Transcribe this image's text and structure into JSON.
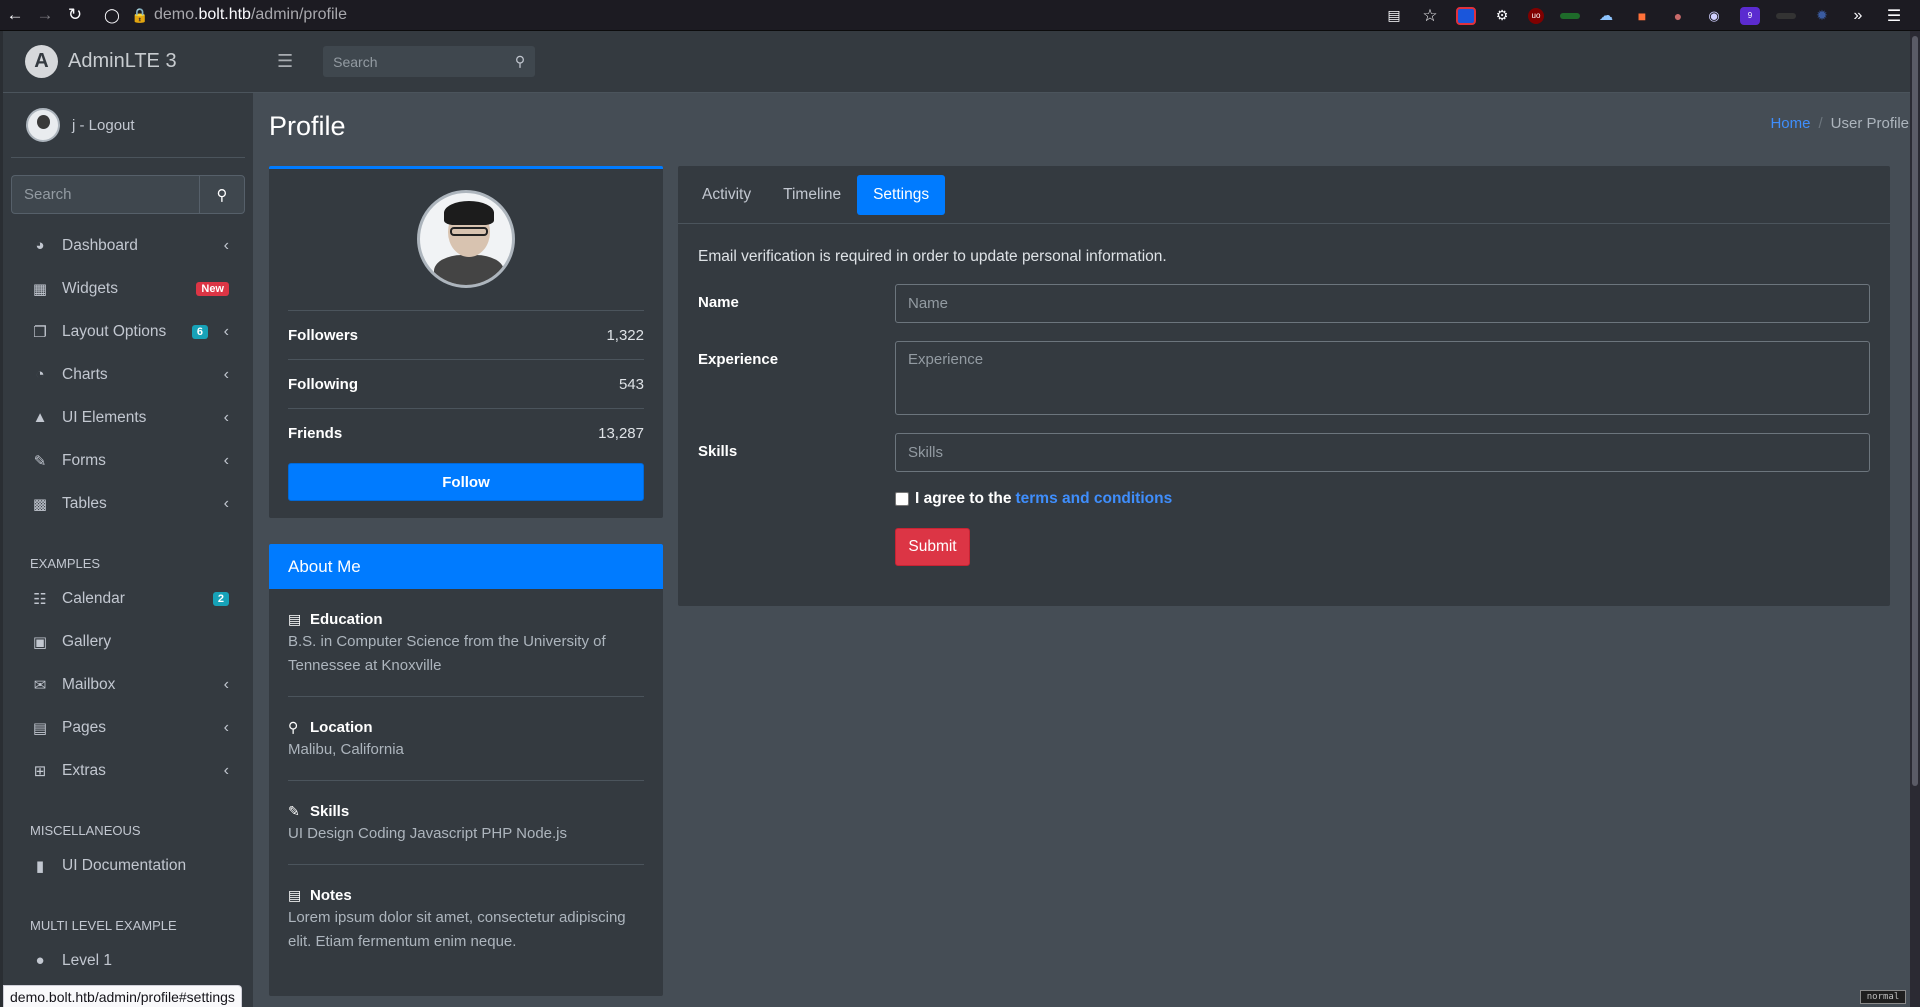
{
  "browser": {
    "url_prefix": "demo.",
    "url_domain": "bolt.htb",
    "url_path": "/admin/profile",
    "status_url": "demo.bolt.htb/admin/profile#settings",
    "mode_tag": "normal"
  },
  "sidebar": {
    "brand": "AdminLTE 3",
    "user": "j - Logout",
    "search_placeholder": "Search",
    "items": [
      {
        "label": "Dashboard",
        "icon": "tachometer-icon",
        "chevron": true
      },
      {
        "label": "Widgets",
        "icon": "th-icon",
        "badge": "New"
      },
      {
        "label": "Layout Options",
        "icon": "copy-icon",
        "badge": "6",
        "chevron": true
      },
      {
        "label": "Charts",
        "icon": "pie-chart-icon",
        "chevron": true
      },
      {
        "label": "UI Elements",
        "icon": "tree-icon",
        "chevron": true
      },
      {
        "label": "Forms",
        "icon": "edit-icon",
        "chevron": true
      },
      {
        "label": "Tables",
        "icon": "table-icon",
        "chevron": true
      }
    ],
    "examples_header": "EXAMPLES",
    "examples": [
      {
        "label": "Calendar",
        "icon": "calendar-icon",
        "badge": "2"
      },
      {
        "label": "Gallery",
        "icon": "image-icon"
      },
      {
        "label": "Mailbox",
        "icon": "envelope-icon",
        "chevron": true
      },
      {
        "label": "Pages",
        "icon": "book-icon",
        "chevron": true
      },
      {
        "label": "Extras",
        "icon": "plus-square-icon",
        "chevron": true
      }
    ],
    "misc_header": "MISCELLANEOUS",
    "misc": [
      {
        "label": "UI Documentation",
        "icon": "file-icon"
      }
    ],
    "multi_header": "MULTI LEVEL EXAMPLE",
    "multi": [
      {
        "label": "Level 1",
        "icon": "circle-icon"
      }
    ]
  },
  "topbar": {
    "search_placeholder": "Search"
  },
  "page": {
    "title": "Profile",
    "breadcrumb_home": "Home",
    "breadcrumb_sep": "/",
    "breadcrumb_current": "User Profile"
  },
  "profile": {
    "stats": [
      {
        "label": "Followers",
        "value": "1,322"
      },
      {
        "label": "Following",
        "value": "543"
      },
      {
        "label": "Friends",
        "value": "13,287"
      }
    ],
    "follow_label": "Follow"
  },
  "about": {
    "header": "About Me",
    "sections": [
      {
        "title": "Education",
        "icon": "book-icon",
        "text": "B.S. in Computer Science from the University of Tennessee at Knoxville"
      },
      {
        "title": "Location",
        "icon": "map-marker-icon",
        "text": "Malibu, California"
      },
      {
        "title": "Skills",
        "icon": "pencil-icon",
        "text": "UI Design Coding Javascript PHP Node.js"
      },
      {
        "title": "Notes",
        "icon": "file-text-icon",
        "text": "Lorem ipsum dolor sit amet, consectetur adipiscing elit. Etiam fermentum enim neque."
      }
    ]
  },
  "settings": {
    "tabs": [
      "Activity",
      "Timeline",
      "Settings"
    ],
    "active_tab": "Settings",
    "notice": "Email verification is required in order to update personal information.",
    "fields": {
      "name_label": "Name",
      "name_placeholder": "Name",
      "experience_label": "Experience",
      "experience_placeholder": "Experience",
      "skills_label": "Skills",
      "skills_placeholder": "Skills"
    },
    "agree_text": "I agree to the",
    "agree_link": "terms and conditions",
    "submit_label": "Submit"
  },
  "colors": {
    "primary": "#007bff",
    "danger": "#dc3545",
    "info": "#17a2b8",
    "sidebar_bg": "#343a40",
    "content_bg": "#454d55"
  }
}
